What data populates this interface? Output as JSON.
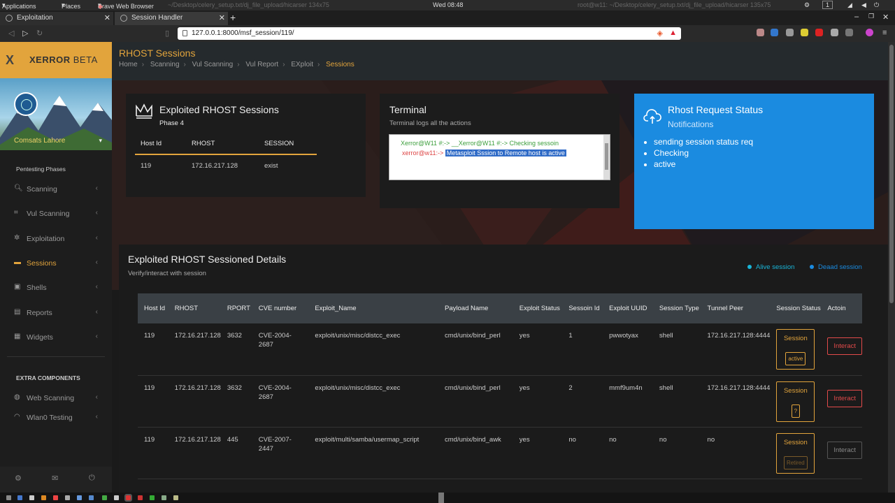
{
  "system_bar": {
    "applications": "Applications",
    "places": "Places",
    "browser": "Brave Web Browser",
    "ghost_title": "~/Desktop/celery_setup.txt/dj_file_upload/hicarser 134x75",
    "clock": "Wed 08:48",
    "ghost_right": "root@w11: ~/Desktop/celery_setup.txt/dj_file_upload/hicarser 135x75",
    "workspace": "1"
  },
  "tabs": [
    {
      "label": "Exploitation"
    },
    {
      "label": "Session Handler"
    }
  ],
  "url": "127.0.0.1:8000/msf_session/119/",
  "brand": {
    "logo": "X",
    "name": "XERROR",
    "suffix": "BETA"
  },
  "user": {
    "name": "Comsats Lahore"
  },
  "sidebar": {
    "section1": "Pentesting Phases",
    "items": [
      {
        "label": "Scanning",
        "icon": "search-icon"
      },
      {
        "label": "Vul Scanning",
        "icon": "scan-icon"
      },
      {
        "label": "Exploitation",
        "icon": "bug-icon"
      },
      {
        "label": "Sessions",
        "icon": "laptop-icon"
      },
      {
        "label": "Shells",
        "icon": "terminal-icon"
      },
      {
        "label": "Reports",
        "icon": "file-icon"
      },
      {
        "label": "Widgets",
        "icon": "grid-icon"
      }
    ],
    "section2": "EXTRA COMPONENTS",
    "extra": [
      {
        "label": "Web Scanning",
        "icon": "globe-icon"
      },
      {
        "label": "Wlan0 Testing",
        "icon": "wifi-icon"
      }
    ]
  },
  "page": {
    "title": "RHOST Sessions",
    "breadcrumb": [
      "Home",
      "Scanning",
      "Vul Scanning",
      "Vul Report",
      "EXploit",
      "Sessions"
    ]
  },
  "exploited_card": {
    "title": "Exploited RHOST Sessions",
    "subtitle": "Phase 4",
    "columns": [
      "Host Id",
      "RHOST",
      "SESSION"
    ],
    "rows": [
      [
        "119",
        "172.16.217.128",
        "exist"
      ]
    ]
  },
  "terminal": {
    "title": "Terminal",
    "subtitle": "Terminal logs all the actions",
    "line1": "Xerror@W11 #:-> __Xerror@W11 #:-> Checking sessoin",
    "line2_prompt": "xerror@w11:->",
    "line2_text": "Metasploit Sssion to Remote host is active"
  },
  "status_card": {
    "title": "Rhost Request Status",
    "subtitle": "Notifications",
    "items": [
      "sending session status req",
      "Checking",
      "active"
    ],
    "color": "#1b8be0"
  },
  "details": {
    "title": "Exploited RHOST Sessioned Details",
    "subtitle": "Verify/interact with session",
    "legend_alive": "Alive session",
    "legend_dead": "Deaad session",
    "columns": [
      "Host Id",
      "RHOST",
      "RPORT",
      "CVE number",
      "Exploit_Name",
      "Payload Name",
      "Exploit Status",
      "Sessoin Id",
      "Exploit UUID",
      "Session Type",
      "Tunnel Peer",
      "Session Status",
      "Actoin"
    ],
    "rows": [
      {
        "host": "119",
        "rhost": "172.16.217.128",
        "rport": "3632",
        "cve": "CVE-2004-2687",
        "exploit": "exploit/unix/misc/distcc_exec",
        "payload": "cmd/unix/bind_perl",
        "status": "yes",
        "sid": "1",
        "uuid": "pwwotyax",
        "type": "shell",
        "peer": "172.16.217.128:4444",
        "sess_label": "Session",
        "sess_tag": "active",
        "action": "Interact"
      },
      {
        "host": "119",
        "rhost": "172.16.217.128",
        "rport": "3632",
        "cve": "CVE-2004-2687",
        "exploit": "exploit/unix/misc/distcc_exec",
        "payload": "cmd/unix/bind_perl",
        "status": "yes",
        "sid": "2",
        "uuid": "mmf9um4n",
        "type": "shell",
        "peer": "172.16.217.128:4444",
        "sess_label": "Session",
        "sess_tag": "?",
        "action": "Interact"
      },
      {
        "host": "119",
        "rhost": "172.16.217.128",
        "rport": "445",
        "cve": "CVE-2007-2447",
        "exploit": "exploit/multi/samba/usermap_script",
        "payload": "cmd/unix/bind_awk",
        "status": "yes",
        "sid": "no",
        "uuid": "no",
        "type": "no",
        "peer": "no",
        "sess_label": "Session",
        "sess_tag": "Retired",
        "action": "Interact"
      }
    ]
  },
  "colors": {
    "accent": "#e2a43c",
    "danger": "#e24a4a",
    "alive": "#19b5d8",
    "dead": "#1b8be0"
  }
}
